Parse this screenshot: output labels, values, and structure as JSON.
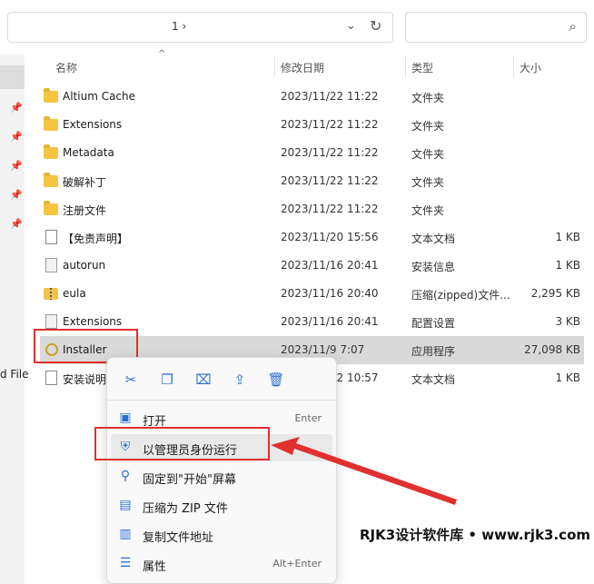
{
  "toolbar": {
    "breadcrumb": "1  ›",
    "dropdown_icon": "chevron-down-icon",
    "refresh_icon": "refresh-icon",
    "search_icon": "search-icon"
  },
  "nav": {
    "cut_label": "d File"
  },
  "columns": {
    "name": "名称",
    "date": "修改日期",
    "type": "类型",
    "size": "大小"
  },
  "files": [
    {
      "name": "Altium Cache",
      "date": "2023/11/22 11:22",
      "type": "文件夹",
      "size": "",
      "icon": "folder"
    },
    {
      "name": "Extensions",
      "date": "2023/11/22 11:22",
      "type": "文件夹",
      "size": "",
      "icon": "folder"
    },
    {
      "name": "Metadata",
      "date": "2023/11/22 11:22",
      "type": "文件夹",
      "size": "",
      "icon": "folder"
    },
    {
      "name": "破解补丁",
      "date": "2023/11/22 11:22",
      "type": "文件夹",
      "size": "",
      "icon": "folder"
    },
    {
      "name": "注册文件",
      "date": "2023/11/22 11:22",
      "type": "文件夹",
      "size": "",
      "icon": "folder"
    },
    {
      "name": "【免责声明】",
      "date": "2023/11/20 15:56",
      "type": "文本文档",
      "size": "1 KB",
      "icon": "doc"
    },
    {
      "name": "autorun",
      "date": "2023/11/16 20:41",
      "type": "安装信息",
      "size": "1 KB",
      "icon": "gear"
    },
    {
      "name": "eula",
      "date": "2023/11/16 20:40",
      "type": "压缩(zipped)文件...",
      "size": "2,295 KB",
      "icon": "zip"
    },
    {
      "name": "Extensions",
      "date": "2023/11/16 20:41",
      "type": "配置设置",
      "size": "3 KB",
      "icon": "gear"
    },
    {
      "name": "Installer",
      "date": "2023/11/9 7:07",
      "type": "应用程序",
      "size": "27,098 KB",
      "icon": "app"
    },
    {
      "name": "安装说明",
      "date": "2023/11/22 10:57",
      "type": "文本文档",
      "size": "1 KB",
      "icon": "doc"
    }
  ],
  "context_menu": {
    "quick_actions": [
      "cut-icon",
      "copy-icon",
      "rename-icon",
      "share-icon",
      "delete-icon"
    ],
    "items": [
      {
        "label": "打开",
        "accel": "Enter",
        "icon": "open-icon"
      },
      {
        "label": "以管理员身份运行",
        "accel": "",
        "icon": "shield-icon"
      },
      {
        "label": "固定到\"开始\"屏幕",
        "accel": "",
        "icon": "pin-icon"
      },
      {
        "label": "压缩为 ZIP 文件",
        "accel": "",
        "icon": "zip-icon"
      },
      {
        "label": "复制文件地址",
        "accel": "",
        "icon": "copy-path-icon"
      },
      {
        "label": "属性",
        "accel": "Alt+Enter",
        "icon": "properties-icon"
      }
    ]
  },
  "watermark": "RJK3设计软件库 • www.rjk3.com",
  "colors": {
    "highlight_box": "#e03030",
    "accent": "#2a6fd6"
  }
}
